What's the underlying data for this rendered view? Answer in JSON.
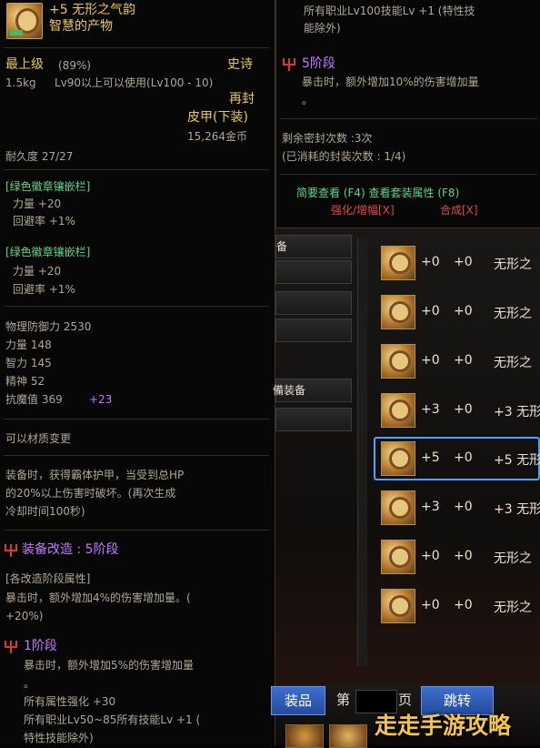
{
  "item": {
    "name": "+5 无形之气韵",
    "subtitle": "智慧的产物",
    "grade": "最上级",
    "grade_pct": "(89%)",
    "rarity": "史诗",
    "weight": "1.5kg",
    "level_req": "Lv90以上可以使用(Lv100 - 10)",
    "reseal": "再封",
    "type": "皮甲(下装)",
    "price": "15,264金币",
    "durability": "耐久度 27/27",
    "slot1_title": "[绿色徽章镶嵌栏]",
    "slot1_stat1": "力量 +20",
    "slot1_stat2": "回避率 +1%",
    "slot2_title": "[绿色徽章镶嵌栏]",
    "slot2_stat1": "力量 +20",
    "slot2_stat2": "回避率 +1%",
    "phys_def": "物理防御力 2530",
    "str": "力量 148",
    "int": "智力 145",
    "spirit": "精神 52",
    "magic_res": "抗魔值 369",
    "magic_res_bonus": "+23",
    "material_change": "可以材质变更",
    "effect_l1": "装备时，获得霸体护甲，当受到总HP",
    "effect_l2": "的20%以上伤害时破坏。(再次生成",
    "effect_l3": "冷却时间100秒)",
    "upgrade_title": "装备改造 : 5阶段",
    "upgrade_sub": "[各改造阶段属性]",
    "upgrade_l1": "暴击时，额外增加4%的伤害增加量。(",
    "upgrade_l2": "+20%)",
    "stage1_title": "1阶段",
    "stage1_l1": "暴击时，额外增加5%的伤害增加量",
    "stage1_l2": "。",
    "stage1_l3": "所有属性强化 +30",
    "stage1_l4": "所有职业Lv50~85所有技能Lv +1 (",
    "stage1_l5": "特性技能除外)"
  },
  "right_tip": {
    "line1": "所有职业Lv100技能Lv +1 (特性技",
    "line2": "能除外)",
    "stage5_title": "5阶段",
    "stage5_l1": "暴击时，额外增加10%的伤害增加量",
    "stage5_l2": "。",
    "seal_remaining": "剩余密封次数 :3次",
    "seal_used": "(已消耗的封装次数 : 1/4)",
    "hint1": "简要查看 (F4) 查看套装属性 (F8)",
    "hint2_a": "强化/增幅[X]",
    "hint2_b": "合成[X]"
  },
  "side_buttons": [
    "备",
    "",
    "",
    "",
    "備装备",
    ""
  ],
  "list_rows": [
    {
      "a": "+0",
      "b": "+0",
      "c": "无形之"
    },
    {
      "a": "+0",
      "b": "+0",
      "c": "无形之"
    },
    {
      "a": "+0",
      "b": "+0",
      "c": "无形之"
    },
    {
      "a": "+3",
      "b": "+0",
      "c": "+3 无形"
    },
    {
      "a": "+5",
      "b": "+0",
      "c": "+5 无形"
    },
    {
      "a": "+3",
      "b": "+0",
      "c": "+3 无形"
    },
    {
      "a": "+0",
      "b": "+0",
      "c": "无形之"
    },
    {
      "a": "+0",
      "b": "+0",
      "c": "无形之"
    }
  ],
  "bottom": {
    "btn_left": "装品",
    "page_label_a": "第",
    "page_label_b": "页",
    "jump": "跳转",
    "watermark": "走走手游攻略"
  },
  "colors": {
    "gold": "#e8c75a",
    "green": "#5fd58a",
    "purple": "#c27bff",
    "red": "#e24a4a",
    "selected_border": "#4aa3ff"
  }
}
